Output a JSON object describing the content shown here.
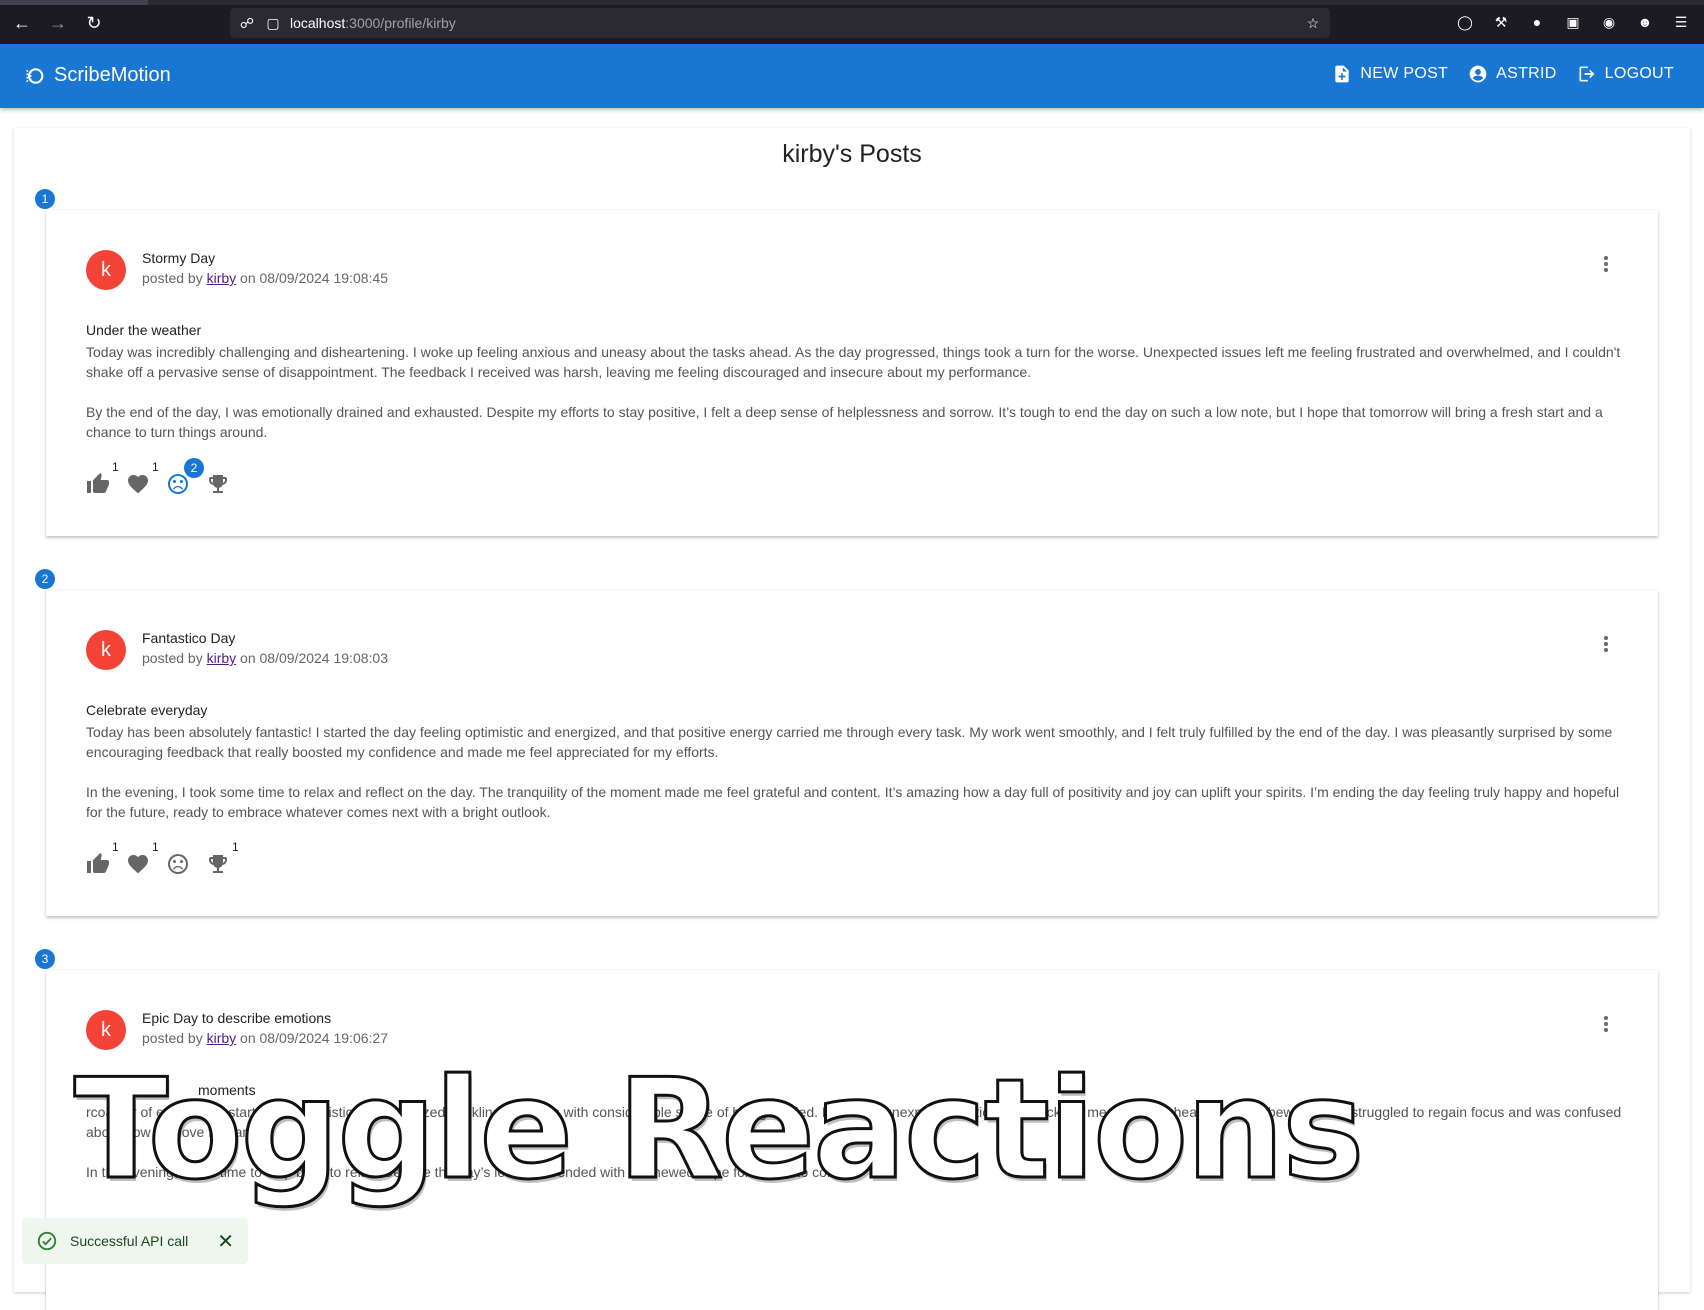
{
  "browser": {
    "url_host": "localhost",
    "url_path": ":3000/profile/kirby"
  },
  "appbar": {
    "brand": "ScribeMotion",
    "new_post": "NEW POST",
    "user": "ASTRID",
    "logout": "LOGOUT"
  },
  "page": {
    "title": "kirby's Posts"
  },
  "posts": [
    {
      "index": "1",
      "avatar": "k",
      "title": "Stormy Day",
      "posted_by": "posted by ",
      "author": "kirby",
      "date": " on 08/09/2024 19:08:45",
      "subtitle": "Under the weather",
      "paragraphs": [
        "Today was incredibly challenging and disheartening. I woke up feeling anxious and uneasy about the tasks ahead. As the day progressed, things took a turn for the worse. Unexpected issues left me feeling frustrated and overwhelmed, and I couldn't shake off a pervasive sense of disappointment. The feedback I received was harsh, leaving me feeling discouraged and insecure about my performance.",
        "By the end of the day, I was emotionally drained and exhausted. Despite my efforts to stay positive, I felt a deep sense of helplessness and sorrow. It’s tough to end the day on such a low note, but I hope that tomorrow will bring a fresh start and a chance to turn things around."
      ],
      "reactions": {
        "like": "1",
        "love": "1",
        "sad": "2",
        "trophy": ""
      }
    },
    {
      "index": "2",
      "avatar": "k",
      "title": "Fantastico Day",
      "posted_by": "posted by ",
      "author": "kirby",
      "date": " on 08/09/2024 19:08:03",
      "subtitle": "Celebrate everyday",
      "paragraphs": [
        "Today has been absolutely fantastic! I started the day feeling optimistic and energized, and that positive energy carried me through every task. My work went smoothly, and I felt truly fulfilled by the end of the day. I was pleasantly surprised by some encouraging feedback that really boosted my confidence and made me feel appreciated for my efforts.",
        "In the evening, I took some time to relax and reflect on the day. The tranquility of the moment made me feel grateful and content. It’s amazing how a day full of positivity and joy can uplift your spirits. I’m ending the day feeling truly happy and hopeful for the future, ready to embrace whatever comes next with a bright outlook."
      ],
      "reactions": {
        "like": "1",
        "love": "1",
        "sad": "",
        "trophy": "1"
      }
    },
    {
      "index": "3",
      "avatar": "k",
      "title": "Epic Day to describe emotions",
      "posted_by": "posted by ",
      "author": "kirby",
      "date": " on 08/09/2024 19:06:27",
      "subtitle": "moments",
      "paragraphs": [
        "rcoaster of emotions. I started off optimistic and energized, tackling my tasks with considerable sense of being fulfilled. However, unexpected critical feedback left me feeling disheartened and bewildered. I struggled to regain focus and was confused about how to move forward.",
        "In the evening, I took time to step back to relax. Despite the day’s lessons, I ended with a renewed hope for what's to come."
      ]
    }
  ],
  "overlay": {
    "caption": "Toggle Reactions"
  },
  "snackbar": {
    "message": "Successful API call"
  }
}
